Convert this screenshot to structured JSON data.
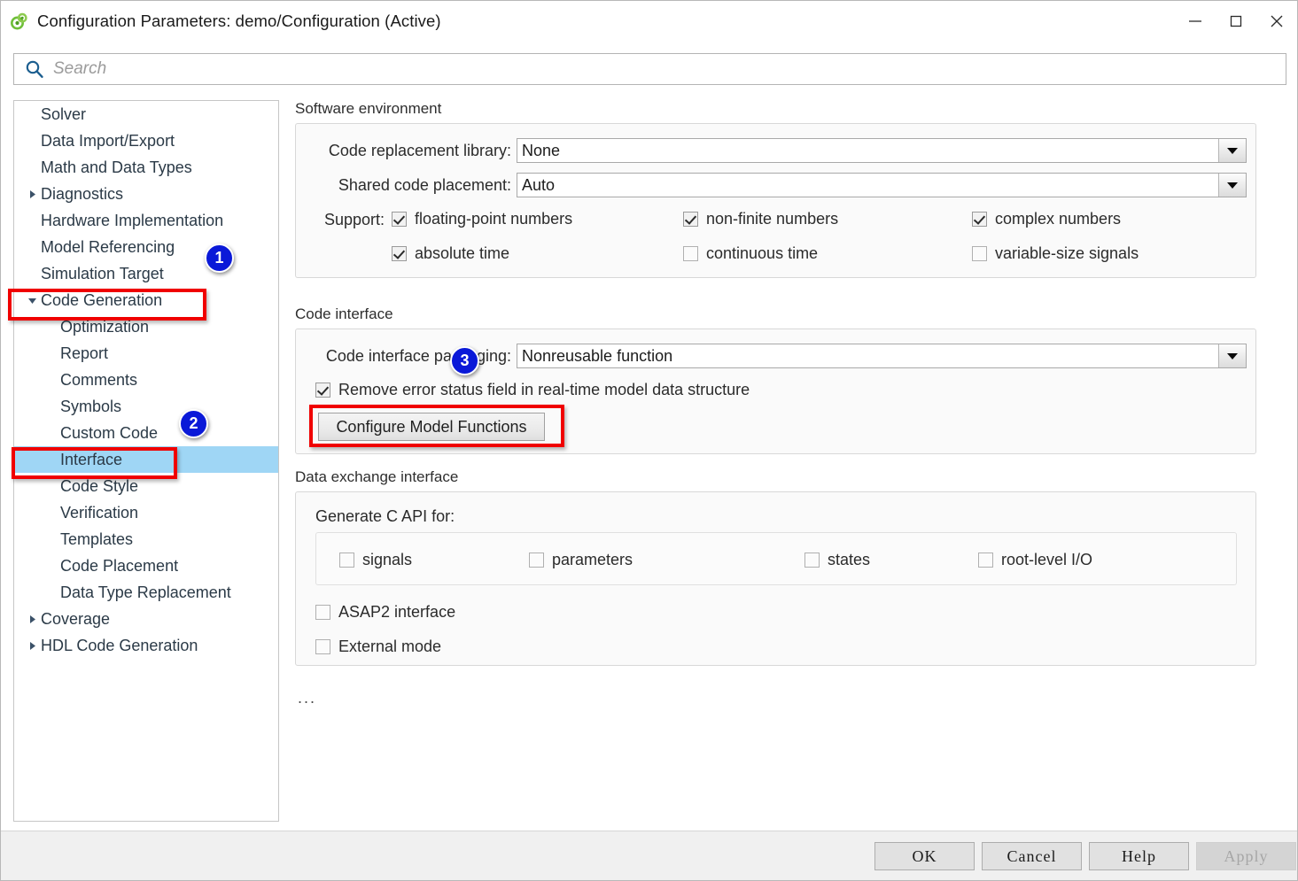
{
  "window": {
    "title": "Configuration Parameters: demo/Configuration (Active)",
    "icon": "simulink-icon",
    "minimize_label": "—",
    "maximize_label": "□",
    "close_label": "✕"
  },
  "search": {
    "placeholder": "Search",
    "value": "",
    "icon": "search-icon"
  },
  "tree": {
    "items": [
      {
        "label": "Solver",
        "level": 0,
        "arrow": "none",
        "selected": false
      },
      {
        "label": "Data Import/Export",
        "level": 0,
        "arrow": "none",
        "selected": false
      },
      {
        "label": "Math and Data Types",
        "level": 0,
        "arrow": "none",
        "selected": false
      },
      {
        "label": "Diagnostics",
        "level": 0,
        "arrow": "collapsed",
        "selected": false
      },
      {
        "label": "Hardware Implementation",
        "level": 0,
        "arrow": "none",
        "selected": false
      },
      {
        "label": "Model Referencing",
        "level": 0,
        "arrow": "none",
        "selected": false
      },
      {
        "label": "Simulation Target",
        "level": 0,
        "arrow": "none",
        "selected": false
      },
      {
        "label": "Code Generation",
        "level": 0,
        "arrow": "expanded",
        "selected": false
      },
      {
        "label": "Optimization",
        "level": 1,
        "arrow": "none",
        "selected": false
      },
      {
        "label": "Report",
        "level": 1,
        "arrow": "none",
        "selected": false
      },
      {
        "label": "Comments",
        "level": 1,
        "arrow": "none",
        "selected": false
      },
      {
        "label": "Symbols",
        "level": 1,
        "arrow": "none",
        "selected": false
      },
      {
        "label": "Custom Code",
        "level": 1,
        "arrow": "none",
        "selected": false
      },
      {
        "label": "Interface",
        "level": 1,
        "arrow": "none",
        "selected": true
      },
      {
        "label": "Code Style",
        "level": 1,
        "arrow": "none",
        "selected": false
      },
      {
        "label": "Verification",
        "level": 1,
        "arrow": "none",
        "selected": false
      },
      {
        "label": "Templates",
        "level": 1,
        "arrow": "none",
        "selected": false
      },
      {
        "label": "Code Placement",
        "level": 1,
        "arrow": "none",
        "selected": false
      },
      {
        "label": "Data Type Replacement",
        "level": 1,
        "arrow": "none",
        "selected": false
      },
      {
        "label": "Coverage",
        "level": 0,
        "arrow": "collapsed",
        "selected": false
      },
      {
        "label": "HDL Code Generation",
        "level": 0,
        "arrow": "collapsed",
        "selected": false
      }
    ]
  },
  "software_environment": {
    "group_label": "Software environment",
    "code_replacement_library": {
      "label": "Code replacement library:",
      "value": "None"
    },
    "shared_code_placement": {
      "label": "Shared code placement:",
      "value": "Auto"
    },
    "support_label": "Support:",
    "support": [
      {
        "label": "floating-point numbers",
        "checked": true
      },
      {
        "label": "non-finite numbers",
        "checked": true
      },
      {
        "label": "complex numbers",
        "checked": true
      },
      {
        "label": "absolute time",
        "checked": true
      },
      {
        "label": "continuous time",
        "checked": false
      },
      {
        "label": "variable-size signals",
        "checked": false
      }
    ]
  },
  "code_interface": {
    "group_label": "Code interface",
    "packaging": {
      "label": "Code interface packaging:",
      "value": "Nonreusable function"
    },
    "remove_error_status": {
      "label": "Remove error status field in real-time model data structure",
      "checked": true
    },
    "configure_button": "Configure Model Functions"
  },
  "data_exchange": {
    "group_label": "Data exchange interface",
    "generate_c_api_label": "Generate C API for:",
    "c_api_options": [
      {
        "label": "signals",
        "checked": false
      },
      {
        "label": "parameters",
        "checked": false
      },
      {
        "label": "states",
        "checked": false
      },
      {
        "label": "root-level I/O",
        "checked": false
      }
    ],
    "asap2": {
      "label": "ASAP2 interface",
      "checked": false
    },
    "external_mode": {
      "label": "External mode",
      "checked": false
    }
  },
  "overflow_indicator": "...",
  "footer": {
    "ok": "OK",
    "cancel": "Cancel",
    "help": "Help",
    "apply": "Apply",
    "apply_disabled": true
  },
  "annotations": {
    "badges": [
      {
        "number": "1"
      },
      {
        "number": "2"
      },
      {
        "number": "3"
      }
    ],
    "accent_color": "#f00000",
    "badge_color": "#0a19d8",
    "selection_color": "#9fd6f5"
  }
}
